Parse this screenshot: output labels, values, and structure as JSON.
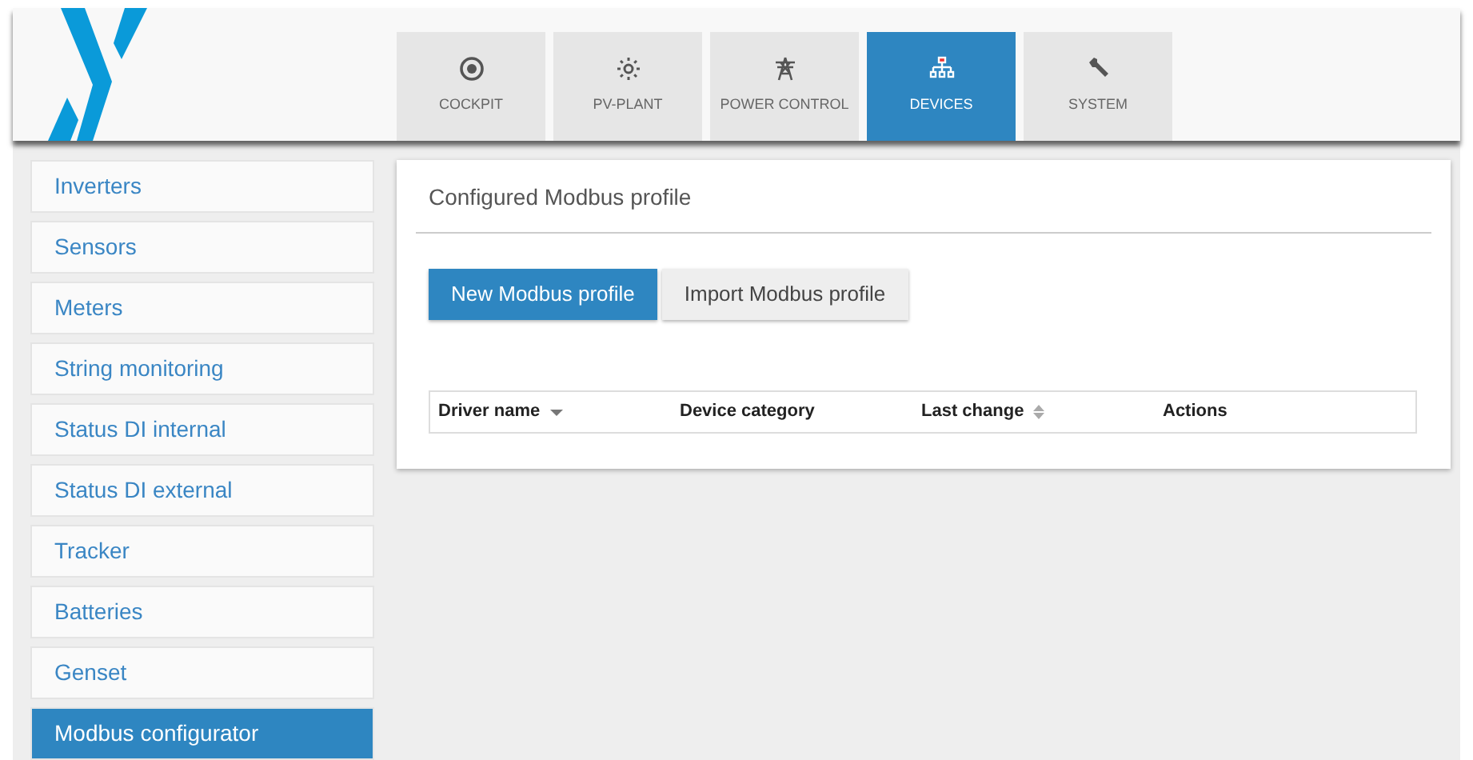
{
  "nav_tabs": [
    {
      "label": "COCKPIT",
      "selected": false
    },
    {
      "label": "PV-PLANT",
      "selected": false
    },
    {
      "label": "POWER CONTROL",
      "selected": false
    },
    {
      "label": "DEVICES",
      "selected": true
    },
    {
      "label": "SYSTEM",
      "selected": false
    }
  ],
  "sidebar": {
    "items": [
      {
        "label": "Inverters",
        "selected": false
      },
      {
        "label": "Sensors",
        "selected": false
      },
      {
        "label": "Meters",
        "selected": false
      },
      {
        "label": "String monitoring",
        "selected": false
      },
      {
        "label": "Status DI internal",
        "selected": false
      },
      {
        "label": "Status DI external",
        "selected": false
      },
      {
        "label": "Tracker",
        "selected": false
      },
      {
        "label": "Batteries",
        "selected": false
      },
      {
        "label": "Genset",
        "selected": false
      },
      {
        "label": "Modbus configurator",
        "selected": true
      }
    ]
  },
  "panel": {
    "title": "Configured Modbus profile",
    "buttons": [
      {
        "label": "New Modbus profile",
        "kind": "primary"
      },
      {
        "label": "Import Modbus profile",
        "kind": "secondary"
      }
    ],
    "table": {
      "columns": [
        {
          "label": "Driver name",
          "kind": "sorted"
        },
        {
          "label": "Device category",
          "kind": "plain"
        },
        {
          "label": "Last change",
          "kind": "sortable"
        },
        {
          "label": "Actions",
          "kind": "plain"
        }
      ]
    }
  }
}
